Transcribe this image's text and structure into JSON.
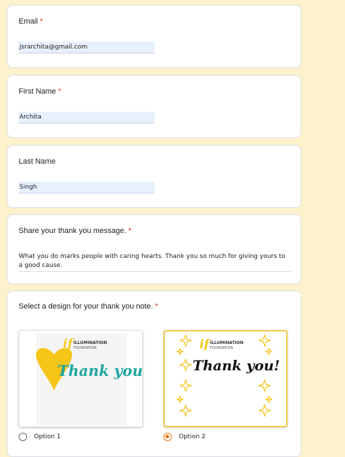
{
  "email": {
    "label": "Email",
    "required_mark": "*",
    "value": "jsrarchita@gmail.com"
  },
  "first_name": {
    "label": "First Name",
    "required_mark": "*",
    "value": "Archita"
  },
  "last_name": {
    "label": "Last Name",
    "value": "Singh"
  },
  "message": {
    "label": "Share your thank you message.",
    "required_mark": "*",
    "value": "What you do marks people with caring hearts. Thank you so much for giving yours to a good cause."
  },
  "design": {
    "label": "Select a design for your thank you note.",
    "required_mark": "*",
    "options": [
      {
        "label": "Option 1",
        "selected": false,
        "logo_mark": "if",
        "logo_line1": "ILLUMINATION",
        "logo_line2": "FOUNDATION",
        "script": "Thank you!"
      },
      {
        "label": "Option 2",
        "selected": true,
        "logo_mark": "if",
        "logo_line1": "ILLUMINATION",
        "logo_line2": "FOUNDATION",
        "script": "Thank you!"
      }
    ]
  },
  "colors": {
    "accent": "#e8710a",
    "required": "#d93025",
    "page_bg": "#fdf2cc",
    "gold": "#f5c518",
    "teal": "#1fa5a0"
  }
}
